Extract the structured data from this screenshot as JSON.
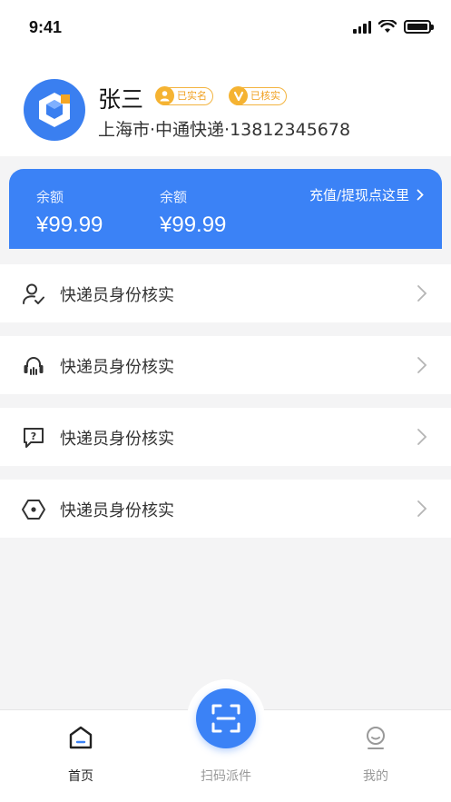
{
  "status_bar": {
    "time": "9:41"
  },
  "profile": {
    "name": "张三",
    "badges": [
      {
        "label": "已实名",
        "icon": "user-verified-icon"
      },
      {
        "label": "已核实",
        "icon": "check-v-icon"
      }
    ],
    "subtitle": "上海市·中通快递·13812345678",
    "avatar_icon": "cube-logo-icon"
  },
  "balance": {
    "items": [
      {
        "label": "余额",
        "value": "¥99.99"
      },
      {
        "label": "余额",
        "value": "¥99.99"
      }
    ],
    "action_label": "充值/提现点这里"
  },
  "menu": {
    "items": [
      {
        "label": "快递员身份核实",
        "icon": "user-check-icon"
      },
      {
        "label": "快递员身份核实",
        "icon": "headset-icon"
      },
      {
        "label": "快递员身份核实",
        "icon": "question-message-icon"
      },
      {
        "label": "快递员身份核实",
        "icon": "hexagon-settings-icon"
      }
    ]
  },
  "tab_bar": {
    "tabs": [
      {
        "label": "首页",
        "icon": "home-icon",
        "active": true
      },
      {
        "label": "扫码派件",
        "icon": "scan-icon",
        "active": false
      },
      {
        "label": "我的",
        "icon": "profile-icon",
        "active": false
      }
    ]
  },
  "colors": {
    "primary": "#3b82f6",
    "badge": "#f3b440",
    "background": "#f4f4f5"
  }
}
